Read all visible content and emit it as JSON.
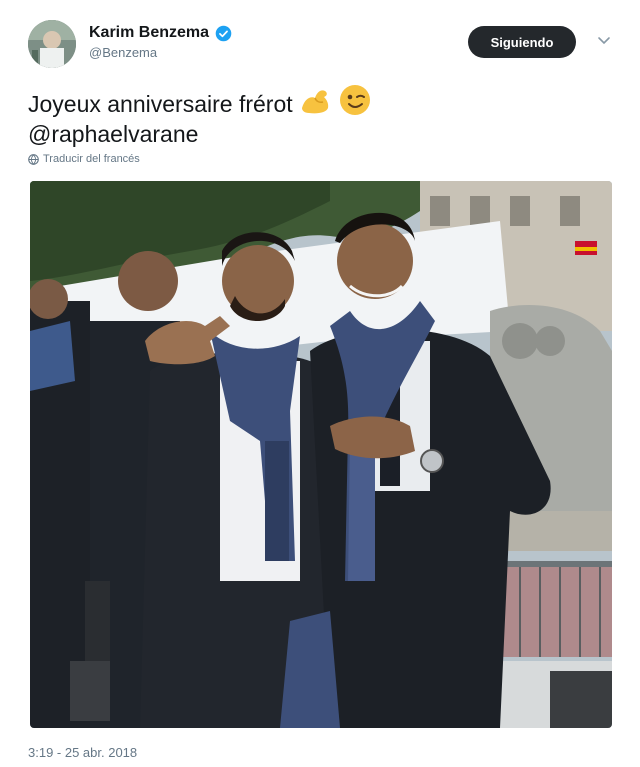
{
  "author": {
    "display_name": "Karim Benzema",
    "handle": "@Benzema",
    "verified": true,
    "avatar_icon": "avatar-photo"
  },
  "follow_button": {
    "label": "Siguiendo"
  },
  "menu": {
    "icon": "chevron-down-icon"
  },
  "tweet": {
    "text_line1": "Joyeux anniversaire frérot",
    "emojis": [
      "flexed-biceps-emoji",
      "winking-face-emoji"
    ],
    "text_line2": "@raphaelvarane",
    "translate_label": "Traducir del francés"
  },
  "media": {
    "type": "photo",
    "icon": "photo-two-players-scarves"
  },
  "timestamp": "3:19 - 25 abr. 2018",
  "colors": {
    "text_primary": "#14171a",
    "text_secondary": "#657786",
    "verified_blue": "#1da1f2",
    "follow_bg": "#24282c"
  }
}
